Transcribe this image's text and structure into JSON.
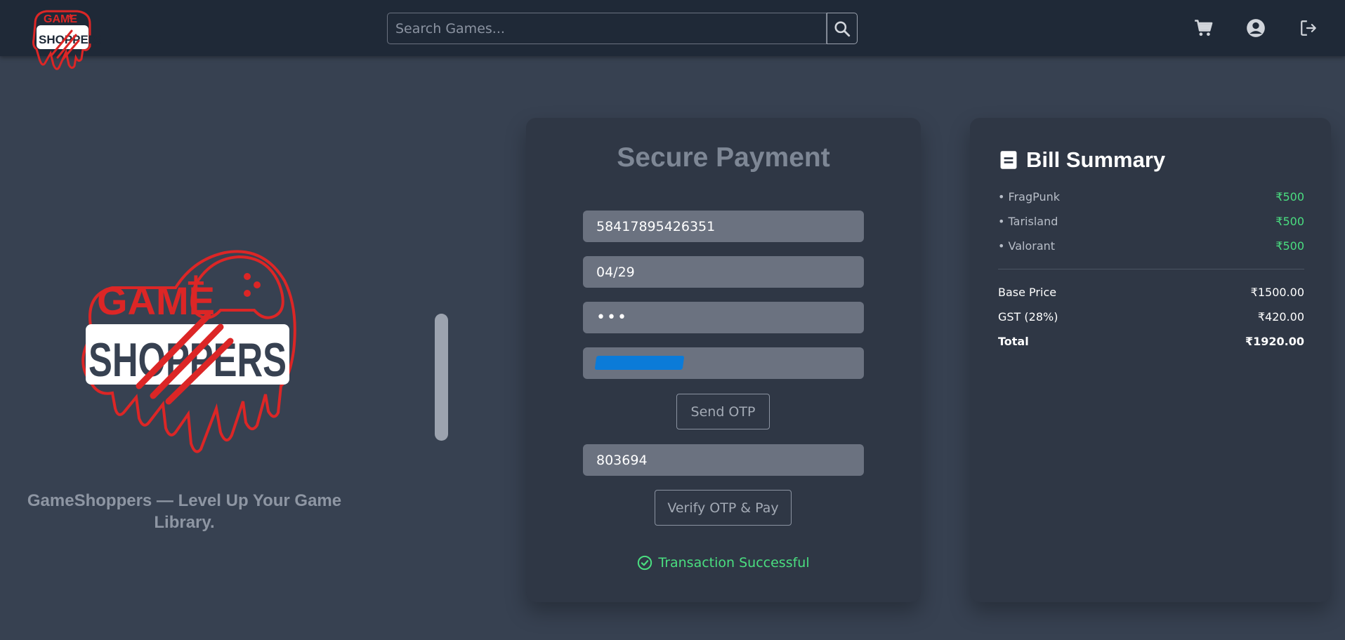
{
  "navbar": {
    "logo_text_top": "GAME",
    "logo_text_bottom": "SHOPPERS",
    "search_placeholder": "Search Games...",
    "icons": [
      "search-icon",
      "cart-icon",
      "account-circle-icon",
      "logout-icon"
    ]
  },
  "branding": {
    "logo_text_top": "GAME",
    "logo_text_bottom": "SHOPPERS",
    "tagline": "GameShoppers — Level Up Your Game Library."
  },
  "payment": {
    "title": "Secure Payment",
    "card_number": "58417895426351",
    "expiry": "04/29",
    "cvv_mask": "•••",
    "send_otp_label": "Send OTP",
    "otp_value": "803694",
    "verify_label": "Verify OTP & Pay",
    "status_text": "Transaction Successful"
  },
  "bill": {
    "title": "Bill Summary",
    "items": [
      {
        "name": "• FragPunk",
        "price": "₹500"
      },
      {
        "name": "• Tarisland",
        "price": "₹500"
      },
      {
        "name": "• Valorant",
        "price": "₹500"
      }
    ],
    "base_label": "Base Price",
    "base_value": "₹1500.00",
    "gst_label": "GST (28%)",
    "gst_value": "₹420.00",
    "total_label": "Total",
    "total_value": "₹1920.00"
  },
  "colors": {
    "navbar_bg": "#1f2937",
    "page_bg": "#374151",
    "card_bg": "#2f3745",
    "brand_red": "#dc2626",
    "success_green": "#4ade80",
    "field_bg": "#6b7280"
  }
}
